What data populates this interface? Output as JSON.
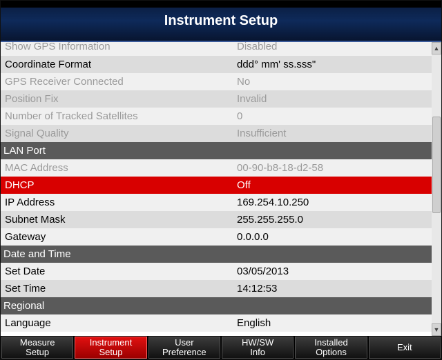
{
  "title": "Instrument Setup",
  "rows": [
    {
      "type": "row",
      "label": "Show GPS Information",
      "value": "Disabled",
      "state": "disabled",
      "cut": true
    },
    {
      "type": "row",
      "label": "Coordinate Format",
      "value": "ddd° mm' ss.sss\"",
      "state": "enabled"
    },
    {
      "type": "row",
      "label": "GPS Receiver Connected",
      "value": "No",
      "state": "disabled"
    },
    {
      "type": "row",
      "label": "Position Fix",
      "value": "Invalid",
      "state": "disabled"
    },
    {
      "type": "row",
      "label": "Number of Tracked Satellites",
      "value": "0",
      "state": "disabled"
    },
    {
      "type": "row",
      "label": "Signal Quality",
      "value": "Insufficient",
      "state": "disabled"
    },
    {
      "type": "section",
      "label": "LAN Port"
    },
    {
      "type": "row",
      "label": "MAC Address",
      "value": "00-90-b8-18-d2-58",
      "state": "disabled"
    },
    {
      "type": "row",
      "label": "DHCP",
      "value": "Off",
      "state": "enabled",
      "selected": true
    },
    {
      "type": "row",
      "label": "IP Address",
      "value": "169.254.10.250",
      "state": "enabled"
    },
    {
      "type": "row",
      "label": "Subnet Mask",
      "value": "255.255.255.0",
      "state": "enabled"
    },
    {
      "type": "row",
      "label": "Gateway",
      "value": "0.0.0.0",
      "state": "enabled"
    },
    {
      "type": "section",
      "label": "Date and Time"
    },
    {
      "type": "row",
      "label": "Set Date",
      "value": "03/05/2013",
      "state": "enabled"
    },
    {
      "type": "row",
      "label": "Set Time",
      "value": "14:12:53",
      "state": "enabled"
    },
    {
      "type": "section",
      "label": "Regional"
    },
    {
      "type": "row",
      "label": "Language",
      "value": "English",
      "state": "enabled"
    }
  ],
  "tabs": [
    {
      "label": "Measure\nSetup",
      "active": false
    },
    {
      "label": "Instrument\nSetup",
      "active": true
    },
    {
      "label": "User\nPreference",
      "active": false
    },
    {
      "label": "HW/SW\nInfo",
      "active": false
    },
    {
      "label": "Installed\nOptions",
      "active": false
    },
    {
      "label": "Exit",
      "active": false
    }
  ],
  "scroll": {
    "up": "▲",
    "down": "▼"
  }
}
